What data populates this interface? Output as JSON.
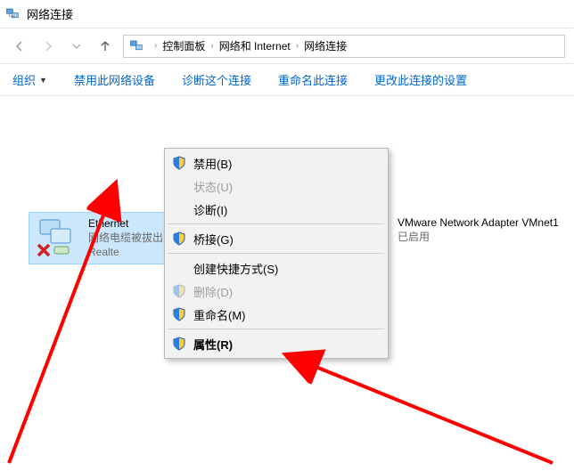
{
  "window": {
    "title": "网络连接"
  },
  "breadcrumb": {
    "items": [
      "控制面板",
      "网络和 Internet",
      "网络连接"
    ]
  },
  "toolbar": {
    "organize": "组织",
    "disable": "禁用此网络设备",
    "diagnose": "诊断这个连接",
    "rename": "重命名此连接",
    "change_settings": "更改此连接的设置"
  },
  "adapters": [
    {
      "name": "Ethernet",
      "status": "网络电缆被拔出",
      "detail": "Realte"
    },
    {
      "name": "VMware Network Adapter VMnet1",
      "status": "已启用",
      "detail": ""
    }
  ],
  "contextmenu": {
    "disable": "禁用(B)",
    "status": "状态(U)",
    "diagnose": "诊断(I)",
    "bridge": "桥接(G)",
    "shortcut": "创建快捷方式(S)",
    "delete": "删除(D)",
    "rename": "重命名(M)",
    "properties": "属性(R)"
  }
}
